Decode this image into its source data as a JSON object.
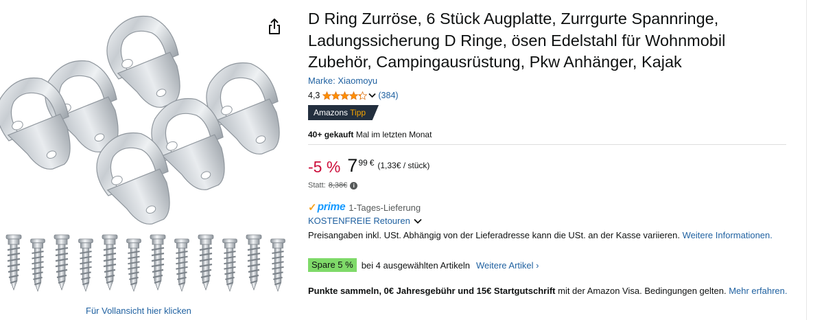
{
  "product": {
    "title": "D Ring Zurröse, 6 Stück Augplatte, Zurrgurte Spannringe, Ladungssicherung D Ringe, ösen Edelstahl für Wohnmobil Zubehör, Campingausrüstung, Pkw Anhänger, Kajak",
    "brand_link": "Marke: Xiaomoyu",
    "rating": "4,3",
    "rating_stars": 4.3,
    "review_count": "(384)",
    "badge_prefix": "Amazons",
    "badge_suffix": "Tipp",
    "bought_bold": "40+ gekauft",
    "bought_rest": " Mal im letzten Monat"
  },
  "price": {
    "discount": "-5 %",
    "whole": "7",
    "fraction": "99",
    "currency": "€",
    "unit_price": "(1,33€ / stück)",
    "list_label": "Statt:",
    "list_value": "8,38€",
    "info_icon_glyph": "i"
  },
  "delivery": {
    "prime_check": "✓",
    "prime_word": "prime",
    "speed": "1-Tages-Lieferung",
    "returns": "KOSTENFREIE Retouren",
    "vat_text": "Preisangaben inkl. USt. Abhängig von der Lieferadresse kann die USt. an der Kasse variieren. ",
    "vat_link": "Weitere Informationen."
  },
  "promo": {
    "spare_badge": "Spare 5 %",
    "spare_text": "bei 4 ausgewählten Artikeln",
    "more_link": "Weitere Artikel ›"
  },
  "visa": {
    "bold": "Punkte sammeln, 0€ Jahresgebühr und 15€ Startgutschrift",
    "text": " mit der Amazon Visa. Bedingungen gelten. ",
    "link": "Mehr erfahren."
  },
  "image": {
    "fullview_link": "Für Vollansicht hier klicken",
    "alt_icon": "share-icon"
  },
  "colors": {
    "link": "#2162A1",
    "discount": "#CC0C39",
    "prime": "#1399FF",
    "star": "#FF8F00",
    "badge_bg": "#232F3E",
    "spare_bg": "#7FDA69"
  }
}
